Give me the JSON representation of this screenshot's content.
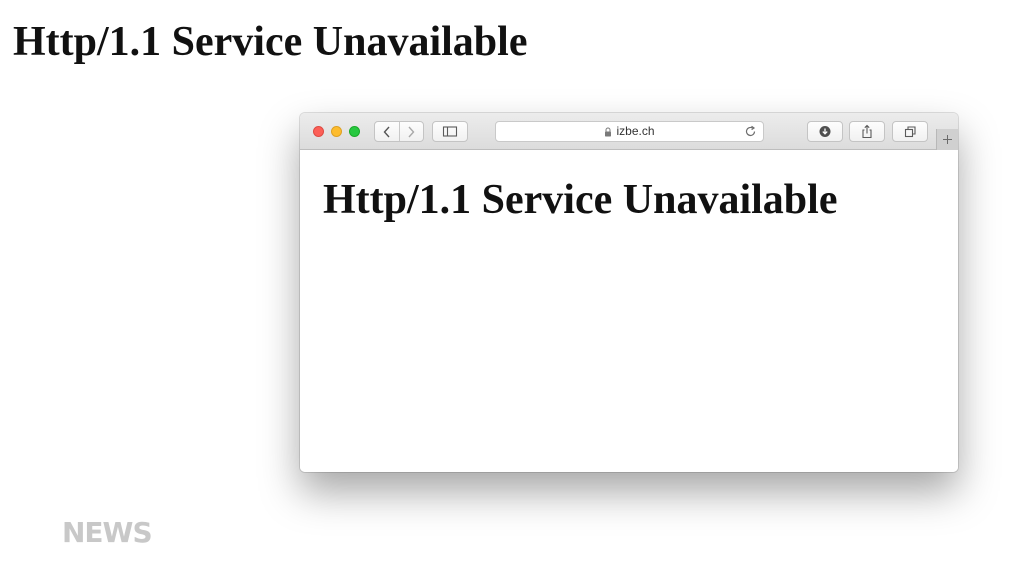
{
  "page": {
    "heading": "Http/1.1 Service Unavailable"
  },
  "browser": {
    "address_bar": {
      "url": "izbe.ch",
      "lock_icon": "lock-icon",
      "reload_icon": "reload-icon"
    },
    "toolbar": {
      "back_icon": "chevron-left-icon",
      "forward_icon": "chevron-right-icon",
      "sidebar_icon": "sidebar-icon",
      "download_icon": "download-icon",
      "share_icon": "share-icon",
      "tabs_icon": "tabs-icon",
      "new_tab_icon": "plus-icon"
    },
    "traffic_lights": {
      "close_color": "#fc5f57",
      "minimize_color": "#fdbc2e",
      "zoom_color": "#27c840"
    },
    "content": {
      "heading": "Http/1.1 Service Unavailable"
    }
  },
  "watermark": {
    "text": "NEWS"
  }
}
